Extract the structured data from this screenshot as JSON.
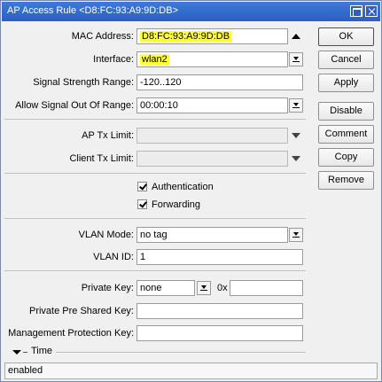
{
  "window": {
    "title": "AP Access Rule <D8:FC:93:A9:9D:DB>"
  },
  "form": {
    "mac_address": {
      "label": "MAC Address:",
      "value": "D8:FC:93:A9:9D:DB"
    },
    "interface": {
      "label": "Interface:",
      "value": "wlan2"
    },
    "signal_strength_range": {
      "label": "Signal Strength Range:",
      "value": "-120..120"
    },
    "allow_signal_out_of_range": {
      "label": "Allow Signal Out Of Range:",
      "value": "00:00:10"
    },
    "ap_tx_limit": {
      "label": "AP Tx Limit:",
      "value": ""
    },
    "client_tx_limit": {
      "label": "Client Tx Limit:",
      "value": ""
    },
    "authentication": {
      "label": "Authentication",
      "checked": true
    },
    "forwarding": {
      "label": "Forwarding",
      "checked": true
    },
    "vlan_mode": {
      "label": "VLAN Mode:",
      "value": "no tag"
    },
    "vlan_id": {
      "label": "VLAN ID:",
      "value": "1"
    },
    "private_key": {
      "label": "Private Key:",
      "value": "none",
      "prefix": "0x",
      "hex_value": ""
    },
    "private_pre_shared_key": {
      "label": "Private Pre Shared Key:",
      "value": ""
    },
    "management_protection_key": {
      "label": "Management Protection Key:",
      "value": ""
    },
    "time_section": {
      "label": "Time"
    }
  },
  "buttons": {
    "ok": "OK",
    "cancel": "Cancel",
    "apply": "Apply",
    "disable": "Disable",
    "comment": "Comment",
    "copy": "Copy",
    "remove": "Remove"
  },
  "status": {
    "text": "enabled"
  },
  "colors": {
    "titlebar": "#2c5fc4",
    "highlight": "#ffff3a"
  }
}
